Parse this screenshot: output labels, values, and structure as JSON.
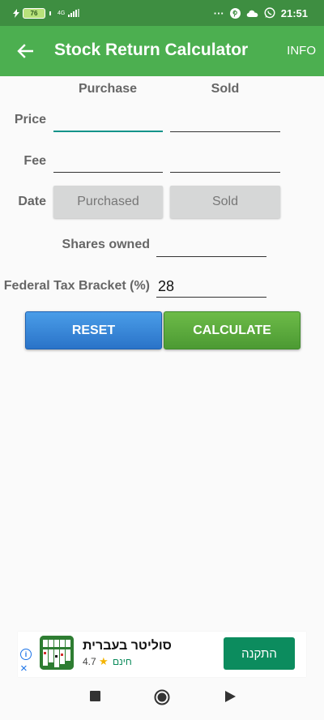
{
  "status_bar": {
    "battery_level": "76",
    "network_type": "4G",
    "dots": "···",
    "time": "21:51",
    "icons": [
      "charging-icon",
      "battery-icon",
      "signal-icon",
      "pinterest-icon",
      "cloud-icon",
      "whatsapp-icon"
    ]
  },
  "app_bar": {
    "title": "Stock Return Calculator",
    "info_label": "INFO",
    "back_icon": "arrow-left-icon"
  },
  "form": {
    "col_purchase": "Purchase",
    "col_sold": "Sold",
    "label_price": "Price",
    "label_fee": "Fee",
    "label_date": "Date",
    "purchase_price": "",
    "sold_price": "",
    "purchase_fee": "",
    "sold_fee": "",
    "date_purchased_btn": "Purchased",
    "date_sold_btn": "Sold",
    "label_shares": "Shares owned",
    "shares_value": "",
    "label_tax": "Federal Tax Bracket (%)",
    "tax_value": "28"
  },
  "actions": {
    "reset_label": "RESET",
    "calculate_label": "CALCULATE",
    "reset_color": "#2f7fd6",
    "calculate_color": "#58a83b"
  },
  "ad": {
    "title": "סוליטר בעברית",
    "rating": "4.7",
    "price": "חינם",
    "install_label": "התקנה",
    "info_icon": "i",
    "close_icon": "×"
  },
  "colors": {
    "status_bar": "#3e8e41",
    "app_bar": "#4caf50",
    "focus_underline": "#11938a"
  }
}
